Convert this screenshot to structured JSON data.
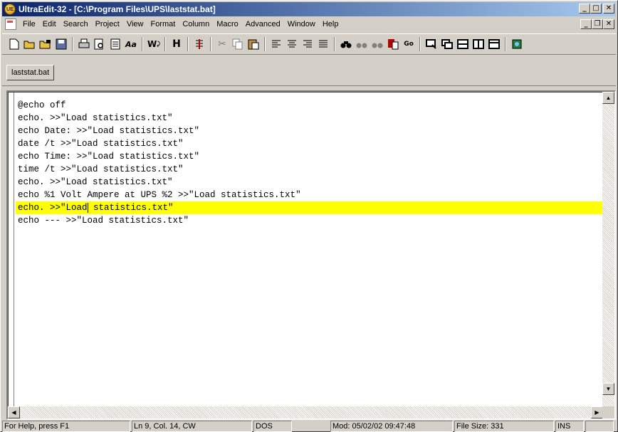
{
  "window": {
    "title": "UltraEdit-32 - [C:\\Program Files\\UPS\\laststat.bat]",
    "minimize": "_",
    "maximize": "□",
    "close": "✕"
  },
  "menu": {
    "items": [
      "File",
      "Edit",
      "Search",
      "Project",
      "View",
      "Format",
      "Column",
      "Macro",
      "Advanced",
      "Window",
      "Help"
    ],
    "doc_minimize": "_",
    "doc_restore": "❐",
    "doc_close": "✕"
  },
  "toolbar": {
    "groups": [
      [
        "new-icon",
        "open-icon",
        "open-ftp-icon",
        "save-icon"
      ],
      [
        "print-icon",
        "print-preview-icon",
        "page-setup-icon",
        "font-icon"
      ],
      [
        "word-wrap-icon"
      ],
      [
        "hex-icon"
      ],
      [
        "column-marker-icon"
      ],
      [
        "cut-icon",
        "copy-icon",
        "paste-icon"
      ],
      [
        "align-left-icon",
        "align-center-icon",
        "align-right-icon",
        "justify-icon"
      ],
      [
        "find-icon",
        "find-in-files-icon",
        "replace-in-files-icon",
        "replace-icon",
        "goto-icon"
      ],
      [
        "window-list-icon",
        "cascade-icon",
        "tile-horizontal-icon",
        "tile-vertical-icon",
        "minimize-all-icon"
      ],
      [
        "project-icon"
      ]
    ]
  },
  "tabs": [
    {
      "label": "laststat.bat"
    }
  ],
  "editor": {
    "lines": [
      "@echo off",
      "echo. >>\"Load statistics.txt\"",
      "echo Date: >>\"Load statistics.txt\"",
      "date /t >>\"Load statistics.txt\"",
      "echo Time: >>\"Load statistics.txt\"",
      "time /t >>\"Load statistics.txt\"",
      "echo. >>\"Load statistics.txt\"",
      "echo %1 Volt Ampere at UPS %2 >>\"Load statistics.txt\"",
      "echo. >>\"Load statistics.txt\"",
      "echo --- >>\"Load statistics.txt\""
    ],
    "active_line": 9,
    "caret_col": 14,
    "highlight_color": "#ffff00"
  },
  "status": {
    "help": "For Help, press F1",
    "position": "Ln 9, Col. 14, CW",
    "format": "DOS",
    "modified": "Mod: 05/02/02 09:47:48",
    "file_size": "File Size: 331",
    "mode": "INS"
  }
}
